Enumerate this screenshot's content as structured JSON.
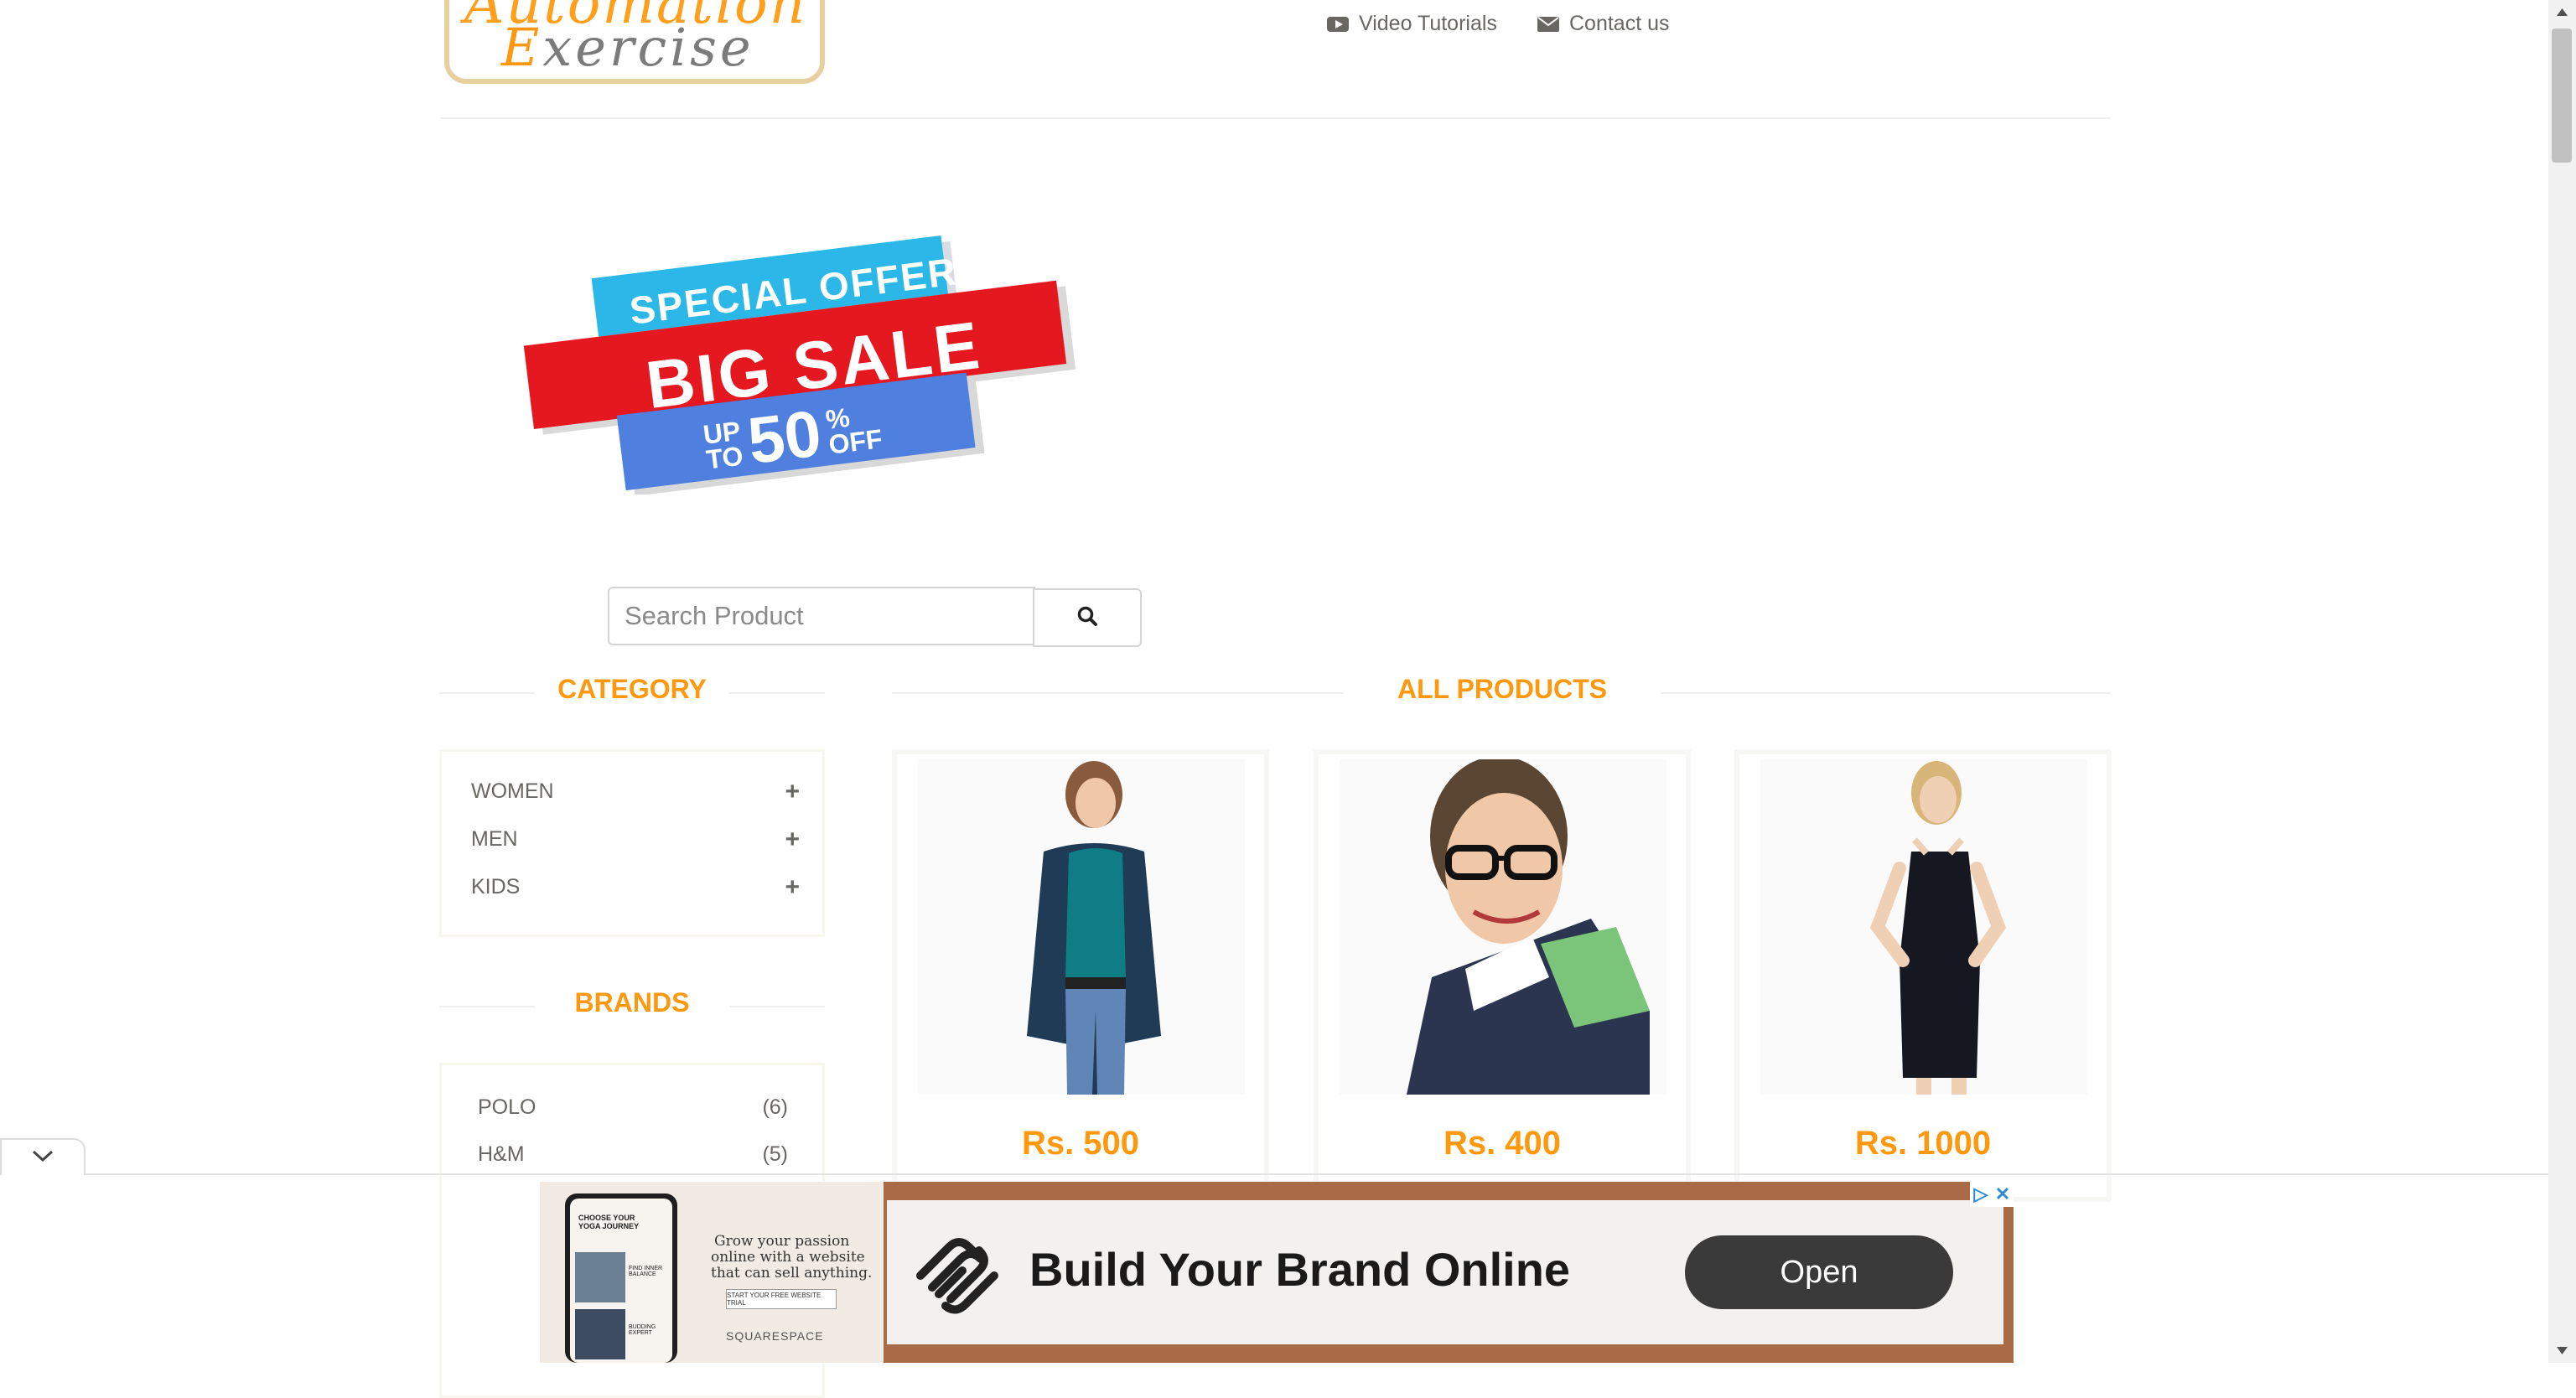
{
  "header": {
    "logo_line1": "Automation",
    "logo_line2_initial": "E",
    "logo_line2_rest": "xercise",
    "nav": [
      {
        "label": "Video Tutorials",
        "icon": "youtube-icon"
      },
      {
        "label": "Contact us",
        "icon": "envelope-icon"
      }
    ]
  },
  "banner": {
    "line1": "SPECIAL OFFER",
    "line2": "BIG SALE",
    "line3_prefix_top": "UP",
    "line3_prefix_bottom": "TO",
    "line3_value": "50",
    "line3_suffix_top": "%",
    "line3_suffix_bottom": "OFF"
  },
  "search": {
    "placeholder": "Search Product",
    "value": "",
    "button_icon": "search-icon"
  },
  "sidebar": {
    "category_title": "Category",
    "categories": [
      {
        "label": "WOMEN",
        "icon": "plus-icon"
      },
      {
        "label": "MEN",
        "icon": "plus-icon"
      },
      {
        "label": "KIDS",
        "icon": "plus-icon"
      }
    ],
    "brands_title": "Brands",
    "brands": [
      {
        "label": "POLO",
        "count": "(6)"
      },
      {
        "label": "H&M",
        "count": "(5)"
      }
    ]
  },
  "products": {
    "title": "All Products",
    "items": [
      {
        "price": "Rs. 500",
        "image": "woman-in-teal-top-and-cardigan"
      },
      {
        "price": "Rs. 400",
        "image": "man-with-glasses-in-polo-shirt"
      },
      {
        "price": "Rs. 1000",
        "image": "woman-in-black-dress"
      }
    ]
  },
  "ad": {
    "left_text_line1": "Grow your passion",
    "left_text_line2": "online with a website",
    "left_text_line3": "that can sell anything.",
    "left_cta": "START YOUR FREE WEBSITE TRIAL",
    "left_brand": "SQUARESPACE",
    "phone_text": "CHOOSE YOUR YOGA JOURNEY",
    "phone_item_1": "FIND INNER BALANCE",
    "phone_item_2": "BUDDING EXPERT",
    "headline": "Build Your Brand Online",
    "cta": "Open",
    "badge_info": "▷",
    "badge_close": "✕"
  },
  "colors": {
    "accent": "#fe980f",
    "text": "#696763",
    "ad_bg": "#a86a47",
    "ad_button": "#3a3a3a"
  }
}
